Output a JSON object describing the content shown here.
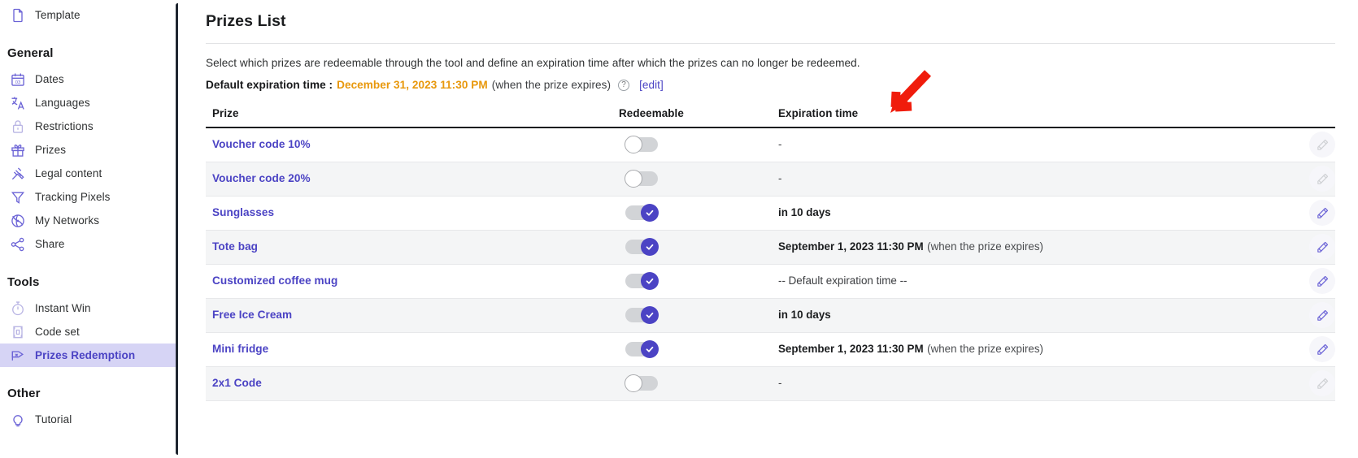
{
  "sidebar": {
    "top_items": [
      {
        "label": "Template",
        "icon": "document-icon"
      }
    ],
    "sections": [
      {
        "title": "General",
        "items": [
          {
            "label": "Dates",
            "icon": "calendar-icon",
            "active": false,
            "dim": false
          },
          {
            "label": "Languages",
            "icon": "translate-icon",
            "active": false,
            "dim": false
          },
          {
            "label": "Restrictions",
            "icon": "lock-icon",
            "active": false,
            "dim": true
          },
          {
            "label": "Prizes",
            "icon": "gift-icon",
            "active": false,
            "dim": false
          },
          {
            "label": "Legal content",
            "icon": "gavel-icon",
            "active": false,
            "dim": false
          },
          {
            "label": "Tracking Pixels",
            "icon": "funnel-icon",
            "active": false,
            "dim": false
          },
          {
            "label": "My Networks",
            "icon": "network-globe-icon",
            "active": false,
            "dim": false
          },
          {
            "label": "Share",
            "icon": "share-icon",
            "active": false,
            "dim": false
          }
        ]
      },
      {
        "title": "Tools",
        "items": [
          {
            "label": "Instant Win",
            "icon": "stopwatch-icon",
            "active": false,
            "dim": true
          },
          {
            "label": "Code set",
            "icon": "ticket-icon",
            "active": false,
            "dim": true
          },
          {
            "label": "Prizes Redemption",
            "icon": "prize-redemption-icon",
            "active": true,
            "dim": false
          }
        ]
      },
      {
        "title": "Other",
        "items": [
          {
            "label": "Tutorial",
            "icon": "lightbulb-icon",
            "active": false,
            "dim": false
          }
        ]
      }
    ]
  },
  "main": {
    "page_title": "Prizes List",
    "description": "Select which prizes are redeemable through the tool and define an expiration time after which the prizes can no longer be redeemed.",
    "default_expiration": {
      "label": "Default expiration time :",
      "date": "December 31, 2023 11:30 PM",
      "note": "(when the prize expires)",
      "help_icon": "question-mark-icon",
      "edit_link": "[edit]"
    },
    "table": {
      "columns": [
        "Prize",
        "Redeemable",
        "Expiration time"
      ],
      "rows": [
        {
          "prize": "Voucher code 10%",
          "redeemable": false,
          "expiration": "-",
          "expiration_note": "",
          "edit_enabled": false
        },
        {
          "prize": "Voucher code 20%",
          "redeemable": false,
          "expiration": "-",
          "expiration_note": "",
          "edit_enabled": false
        },
        {
          "prize": "Sunglasses",
          "redeemable": true,
          "expiration": "in 10 days",
          "expiration_note": "",
          "edit_enabled": true
        },
        {
          "prize": "Tote bag",
          "redeemable": true,
          "expiration": "September 1, 2023 11:30 PM",
          "expiration_note": "(when the prize expires)",
          "edit_enabled": true
        },
        {
          "prize": "Customized coffee mug",
          "redeemable": true,
          "expiration": "-- Default expiration time --",
          "expiration_note": "",
          "edit_enabled": true
        },
        {
          "prize": "Free Ice Cream",
          "redeemable": true,
          "expiration": "in 10 days",
          "expiration_note": "",
          "edit_enabled": true
        },
        {
          "prize": "Mini fridge",
          "redeemable": true,
          "expiration": "September 1, 2023 11:30 PM",
          "expiration_note": "(when the prize expires)",
          "edit_enabled": true
        },
        {
          "prize": "2x1 Code",
          "redeemable": false,
          "expiration": "-",
          "expiration_note": "",
          "edit_enabled": false
        }
      ]
    }
  },
  "annotation": {
    "arrow": "red-arrow-pointing-to-redeemable-column"
  },
  "colors": {
    "accent_purple": "#4b43c4",
    "icon_purple": "#6b63d6",
    "active_bg": "#d6d4f5",
    "warning_orange": "#e8980c",
    "arrow_red": "#f01c0c",
    "row_stripe": "#f4f5f6"
  }
}
